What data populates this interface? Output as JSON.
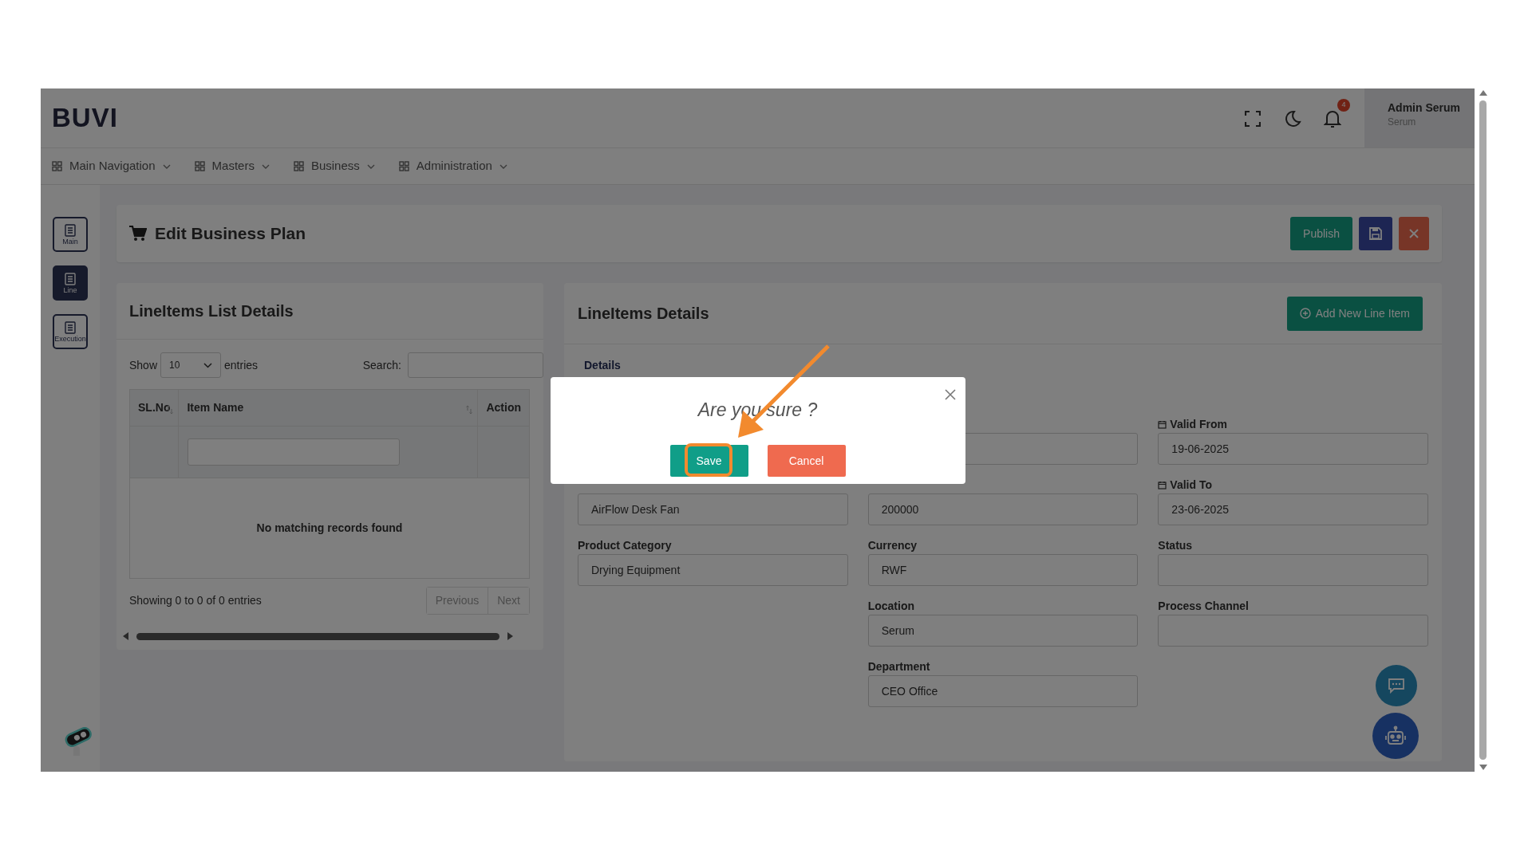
{
  "header": {
    "logo": "BUVI",
    "notifications": "4",
    "user_name": "Admin Serum",
    "user_role": "Serum"
  },
  "nav": [
    {
      "label": "Main Navigation"
    },
    {
      "label": "Masters"
    },
    {
      "label": "Business"
    },
    {
      "label": "Administration"
    }
  ],
  "sidebar": [
    {
      "label": "Main",
      "selected": false
    },
    {
      "label": "Line",
      "selected": true
    },
    {
      "label": "Execution",
      "selected": false
    }
  ],
  "page_title": "Edit Business Plan",
  "page_actions": [
    {
      "kind": "text",
      "label": "Publish"
    },
    {
      "kind": "save"
    },
    {
      "kind": "close"
    }
  ],
  "list_card": {
    "title": "LineItems List Details",
    "show_label": "Show",
    "page_size": "10",
    "entries_label": "entries",
    "search_label": "Search:",
    "columns": [
      {
        "label": "SL.No",
        "sortable": true
      },
      {
        "label": "Item Name",
        "sortable": true
      },
      {
        "label": "Action",
        "sortable": false
      }
    ],
    "empty_message": "No matching records found",
    "info": "Showing 0 to 0 of 0 entries",
    "pager": [
      {
        "label": "Previous",
        "disabled": true
      },
      {
        "label": "Next",
        "disabled": true
      }
    ]
  },
  "detail_card": {
    "title": "LineItems Details",
    "add_button": "Add New Line Item",
    "tabs": [
      {
        "label": "Details",
        "selected": true
      }
    ],
    "columns": [
      [
        {
          "kind": "gap"
        },
        {
          "kind": "text",
          "value": "AirFlow Desk Fan"
        },
        {
          "kind": "text",
          "label": "Product Category",
          "value": "Drying Equipment"
        }
      ],
      [
        {
          "kind": "blank"
        },
        {
          "kind": "text",
          "value": "200000"
        },
        {
          "kind": "text",
          "label": "Currency",
          "value": "RWF"
        },
        {
          "kind": "text",
          "label": "Location",
          "value": "Serum"
        },
        {
          "kind": "text",
          "label": "Department",
          "value": "CEO Office"
        }
      ],
      [
        {
          "kind": "date",
          "label": "Valid From",
          "value": "19-06-2025"
        },
        {
          "kind": "date",
          "label": "Valid To",
          "value": "23-06-2025"
        },
        {
          "kind": "text",
          "label": "Status"
        },
        {
          "kind": "text",
          "label": "Process Channel"
        }
      ]
    ]
  },
  "dialog": {
    "title": "Are you sure ?",
    "buttons": [
      {
        "kind": "confirm",
        "label": "Save",
        "highlighted": true
      },
      {
        "kind": "cancel",
        "label": "Cancel"
      }
    ]
  }
}
